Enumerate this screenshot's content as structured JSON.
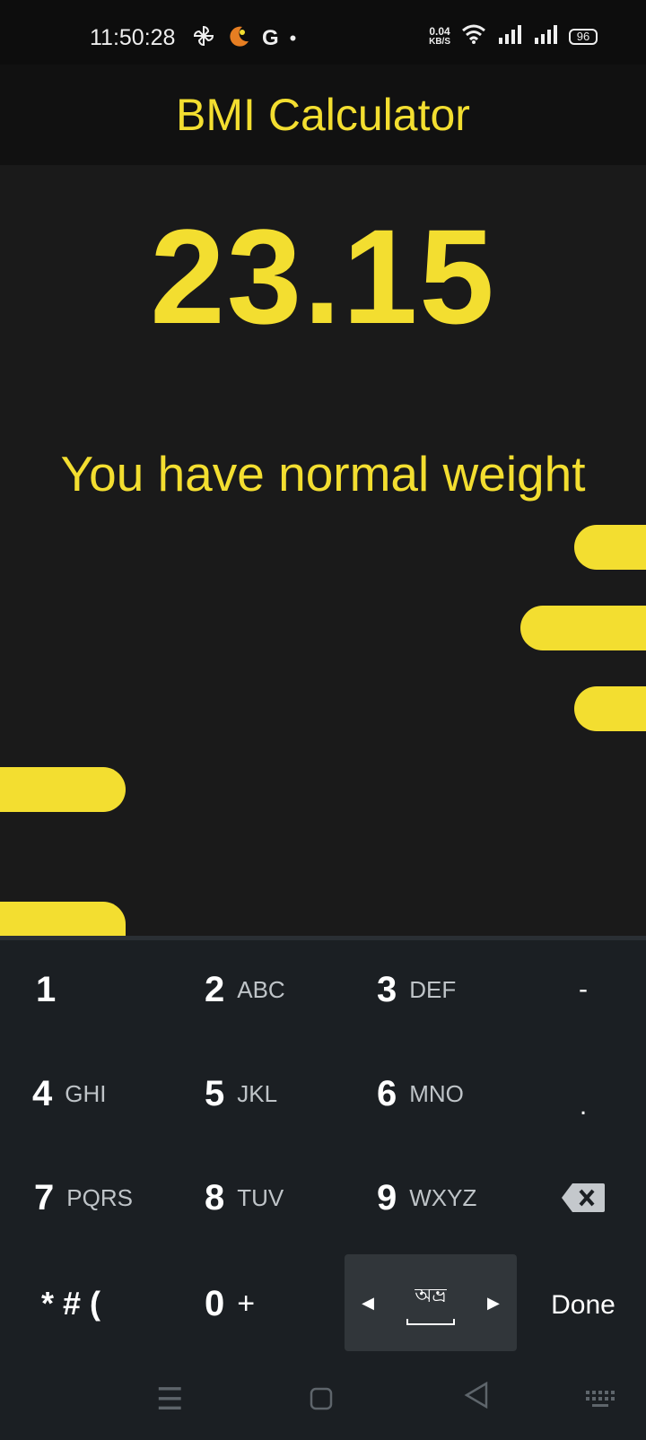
{
  "status": {
    "time": "11:50:28",
    "speed_value": "0.04",
    "speed_unit": "KB/S",
    "battery": "96",
    "icons": [
      "pinwheel-icon",
      "moon-icon",
      "google-icon",
      "dot-icon",
      "wifi-icon",
      "signal-icon",
      "signal-icon",
      "battery-icon"
    ]
  },
  "app": {
    "title": "BMI Calculator"
  },
  "result": {
    "value": "23.15",
    "message": "You have normal weight"
  },
  "keyboard": {
    "rows": [
      [
        {
          "d": "1",
          "l": ""
        },
        {
          "d": "2",
          "l": "ABC"
        },
        {
          "d": "3",
          "l": "DEF"
        },
        {
          "side": "-"
        }
      ],
      [
        {
          "d": "4",
          "l": "GHI"
        },
        {
          "d": "5",
          "l": "JKL"
        },
        {
          "d": "6",
          "l": "MNO"
        },
        {
          "side": "."
        }
      ],
      [
        {
          "d": "7",
          "l": "PQRS"
        },
        {
          "d": "8",
          "l": "TUV"
        },
        {
          "d": "9",
          "l": "WXYZ"
        },
        {
          "side": "backspace-icon"
        }
      ]
    ],
    "bottom_left": "* # (",
    "zero": "0",
    "zero_sub": "+",
    "space_lang": "অভ্র",
    "done": "Done"
  },
  "colors": {
    "accent": "#f3de30",
    "background": "#1a1a1a",
    "keyboard": "#1b1f23"
  }
}
